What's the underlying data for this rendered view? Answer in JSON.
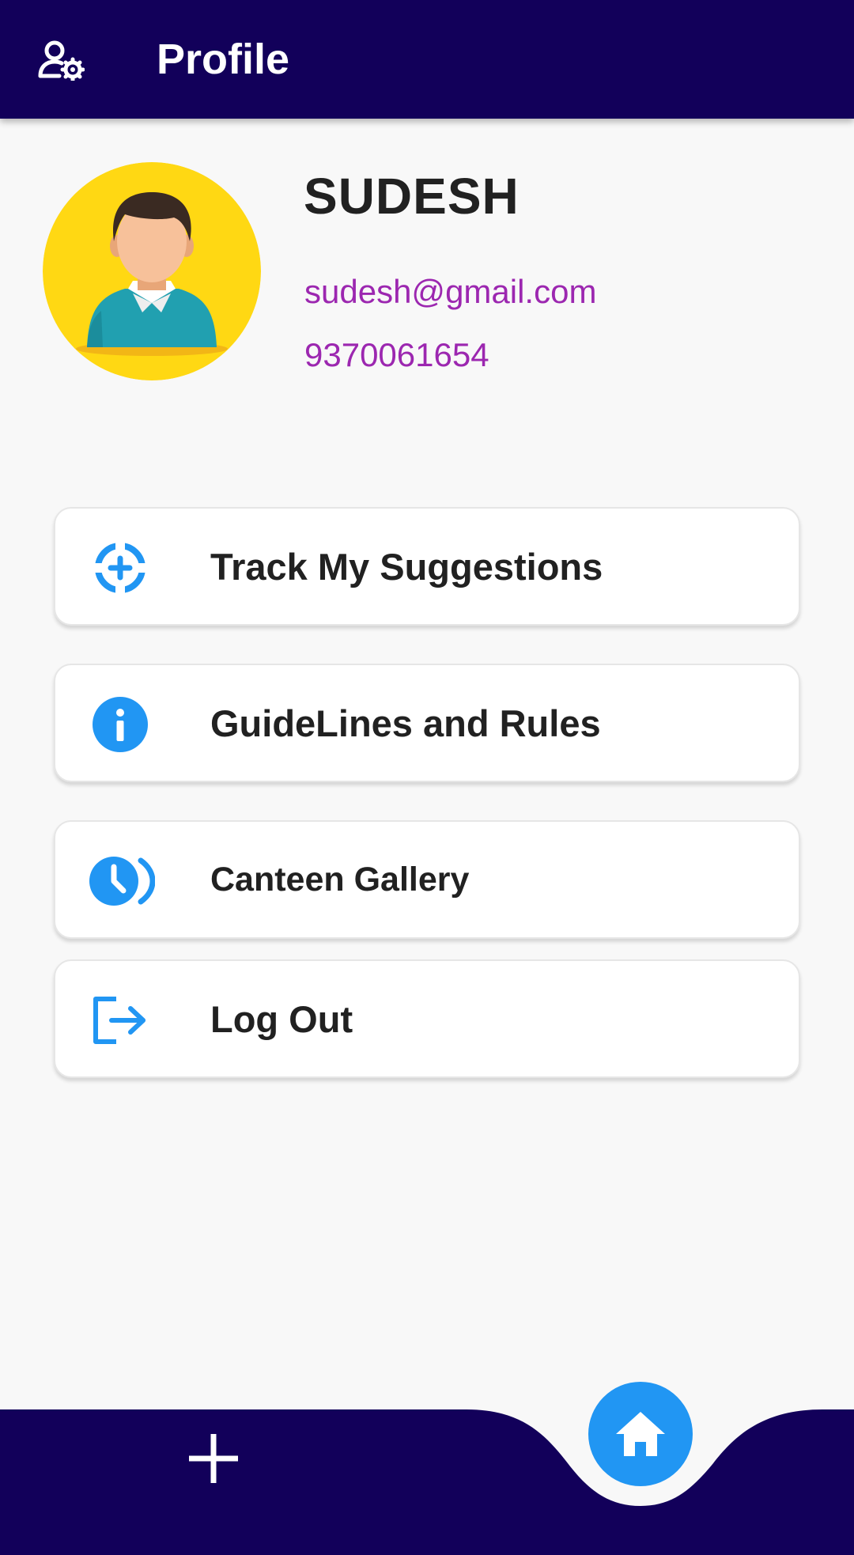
{
  "header": {
    "title": "Profile",
    "settings_icon": "user-settings-icon"
  },
  "profile": {
    "name": "SUDESH",
    "email": "sudesh@gmail.com",
    "phone": "9370061654",
    "avatar_icon": "person-avatar-icon"
  },
  "menu": [
    {
      "label": "Track My Suggestions",
      "icon": "target-plus-icon"
    },
    {
      "label": "GuideLines and Rules",
      "icon": "info-icon"
    },
    {
      "label": "Canteen Gallery",
      "icon": "clock-gallery-icon"
    },
    {
      "label": "Log Out",
      "icon": "logout-icon"
    }
  ],
  "bottom_nav": {
    "add_icon": "plus-icon",
    "home_icon": "home-icon"
  },
  "colors": {
    "primary_dark": "#12005a",
    "accent_blue": "#2196f3",
    "contact_purple": "#9c27b0",
    "avatar_yellow": "#ffd813"
  }
}
